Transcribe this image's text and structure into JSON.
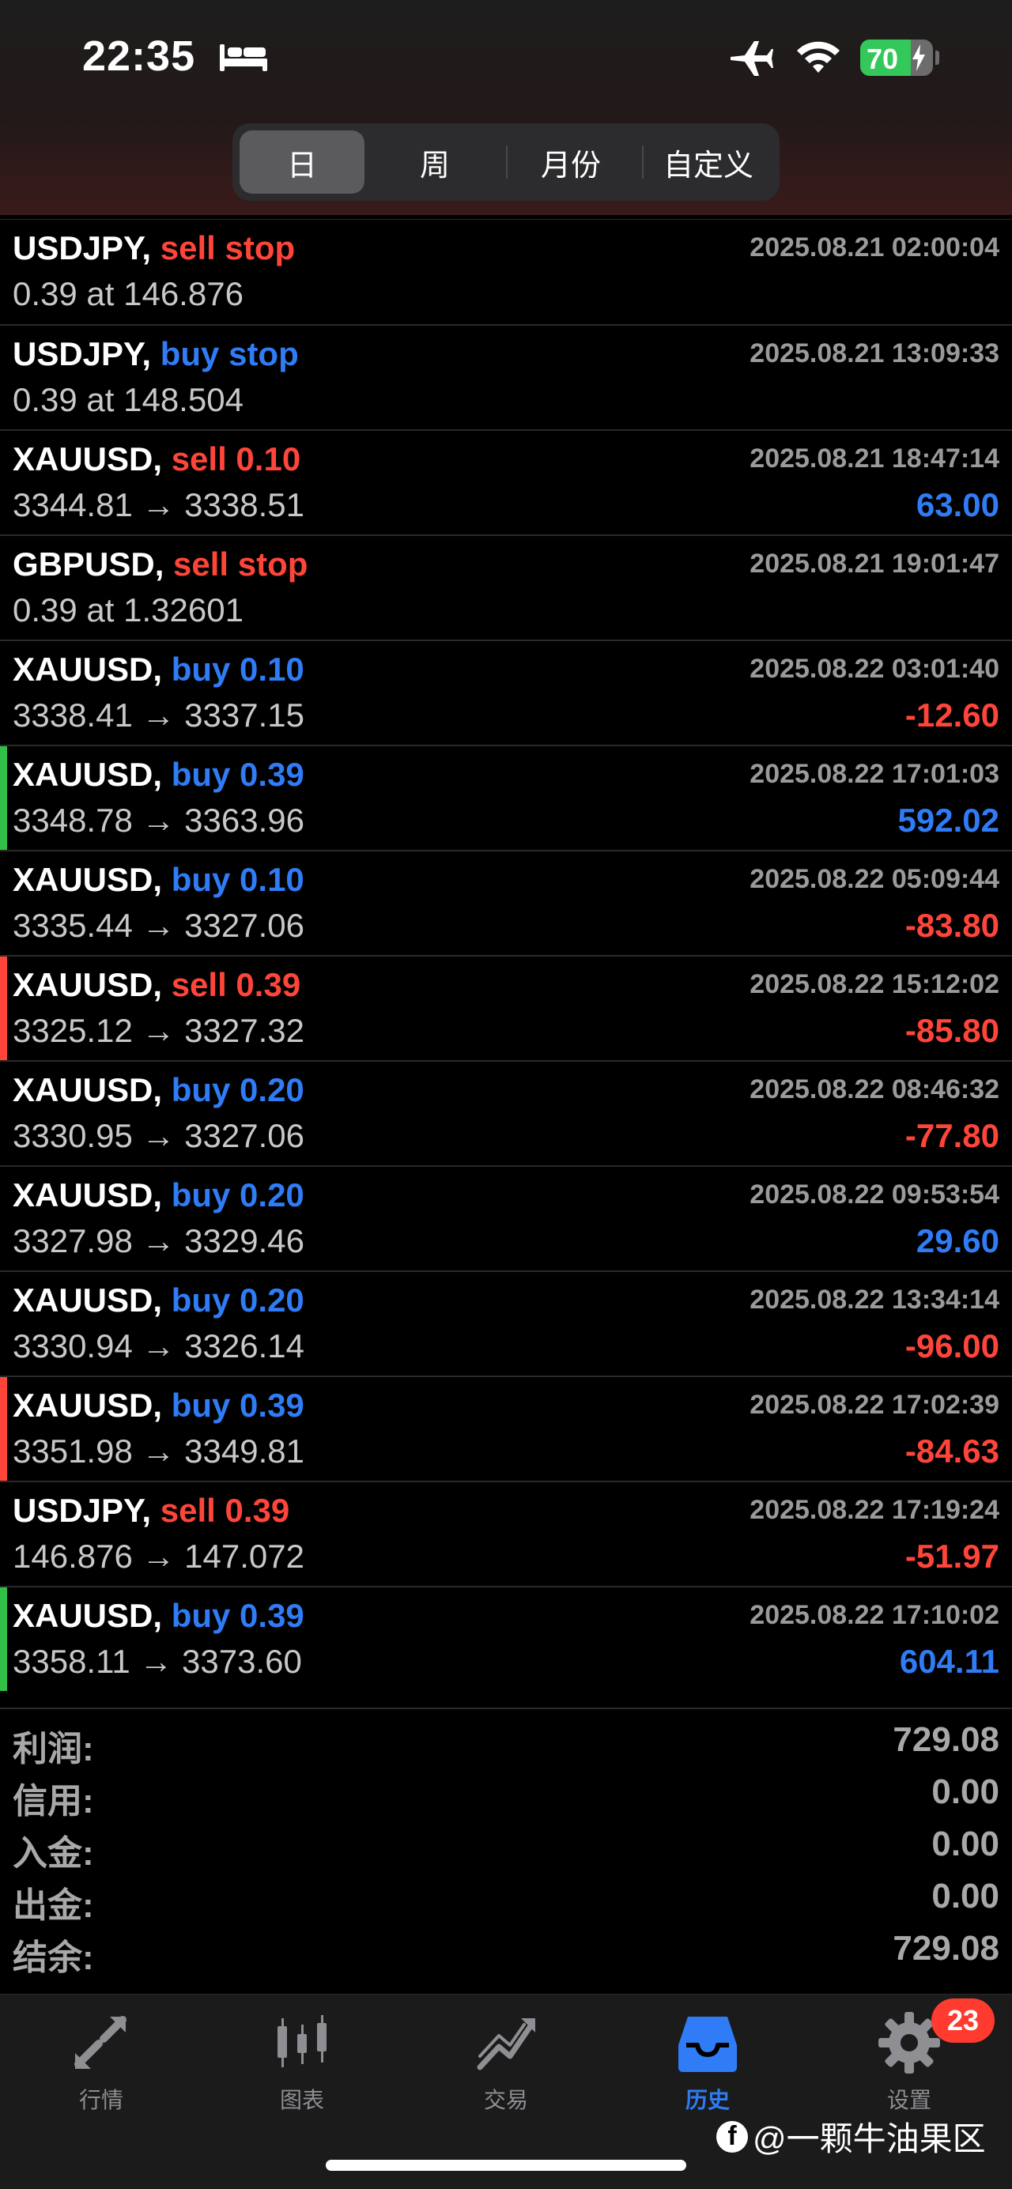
{
  "status_bar": {
    "time": "22:35",
    "battery_level": "70",
    "icons": [
      "bed-icon",
      "airplane-icon",
      "wifi-icon",
      "battery-charging-icon"
    ]
  },
  "period_tabs": [
    "日",
    "周",
    "月份",
    "自定义"
  ],
  "period_selected": "日",
  "colors": {
    "sell": "#ff453a",
    "buy": "#2f7cf6",
    "profit_positive": "#2f7cf6",
    "profit_negative": "#ff453a",
    "marker_green": "#30c048",
    "marker_red": "#ff453a",
    "badge": "#ff3b30"
  },
  "orders": [
    {
      "symbol": "USDJPY,",
      "action": "sell stop",
      "side": "sell",
      "detail": "0.39 at 146.876",
      "time": "2025.08.21 02:00:04",
      "profit": "",
      "marker": ""
    },
    {
      "symbol": "USDJPY,",
      "action": "buy stop",
      "side": "buy",
      "detail": "0.39 at 148.504",
      "time": "2025.08.21 13:09:33",
      "profit": "",
      "marker": ""
    },
    {
      "symbol": "XAUUSD,",
      "action": "sell 0.10",
      "side": "sell",
      "detail": "3344.81 → 3338.51",
      "time": "2025.08.21 18:47:14",
      "profit": "63.00",
      "marker": ""
    },
    {
      "symbol": "GBPUSD,",
      "action": "sell stop",
      "side": "sell",
      "detail": "0.39 at 1.32601",
      "time": "2025.08.21 19:01:47",
      "profit": "",
      "marker": ""
    },
    {
      "symbol": "XAUUSD,",
      "action": "buy 0.10",
      "side": "buy",
      "detail": "3338.41 → 3337.15",
      "time": "2025.08.22 03:01:40",
      "profit": "-12.60",
      "marker": ""
    },
    {
      "symbol": "XAUUSD,",
      "action": "buy 0.39",
      "side": "buy",
      "detail": "3348.78 → 3363.96",
      "time": "2025.08.22 17:01:03",
      "profit": "592.02",
      "marker": "green"
    },
    {
      "symbol": "XAUUSD,",
      "action": "buy 0.10",
      "side": "buy",
      "detail": "3335.44 → 3327.06",
      "time": "2025.08.22 05:09:44",
      "profit": "-83.80",
      "marker": ""
    },
    {
      "symbol": "XAUUSD,",
      "action": "sell 0.39",
      "side": "sell",
      "detail": "3325.12 → 3327.32",
      "time": "2025.08.22 15:12:02",
      "profit": "-85.80",
      "marker": "red"
    },
    {
      "symbol": "XAUUSD,",
      "action": "buy 0.20",
      "side": "buy",
      "detail": "3330.95 → 3327.06",
      "time": "2025.08.22 08:46:32",
      "profit": "-77.80",
      "marker": ""
    },
    {
      "symbol": "XAUUSD,",
      "action": "buy 0.20",
      "side": "buy",
      "detail": "3327.98 → 3329.46",
      "time": "2025.08.22 09:53:54",
      "profit": "29.60",
      "marker": ""
    },
    {
      "symbol": "XAUUSD,",
      "action": "buy 0.20",
      "side": "buy",
      "detail": "3330.94 → 3326.14",
      "time": "2025.08.22 13:34:14",
      "profit": "-96.00",
      "marker": ""
    },
    {
      "symbol": "XAUUSD,",
      "action": "buy 0.39",
      "side": "buy",
      "detail": "3351.98 → 3349.81",
      "time": "2025.08.22 17:02:39",
      "profit": "-84.63",
      "marker": "red"
    },
    {
      "symbol": "USDJPY,",
      "action": "sell 0.39",
      "side": "sell",
      "detail": "146.876 → 147.072",
      "time": "2025.08.22 17:19:24",
      "profit": "-51.97",
      "marker": ""
    },
    {
      "symbol": "XAUUSD,",
      "action": "buy 0.39",
      "side": "buy",
      "detail": "3358.11 → 3373.60",
      "time": "2025.08.22 17:10:02",
      "profit": "604.11",
      "marker": "green"
    }
  ],
  "summary": [
    {
      "label": "利润:",
      "value": "729.08"
    },
    {
      "label": "信用:",
      "value": "0.00"
    },
    {
      "label": "入金:",
      "value": "0.00"
    },
    {
      "label": "出金:",
      "value": "0.00"
    },
    {
      "label": "结余:",
      "value": "729.08"
    }
  ],
  "tabbar": {
    "tabs": [
      {
        "label": "行情",
        "icon": "quotes-arrows-icon"
      },
      {
        "label": "图表",
        "icon": "candlestick-chart-icon"
      },
      {
        "label": "交易",
        "icon": "trade-chart-icon"
      },
      {
        "label": "历史",
        "icon": "history-inbox-icon"
      },
      {
        "label": "设置",
        "icon": "gear-icon"
      }
    ],
    "active": "历史",
    "badge_count": "23"
  },
  "watermark": {
    "logo": "f",
    "text": "@一颗牛油果区"
  }
}
